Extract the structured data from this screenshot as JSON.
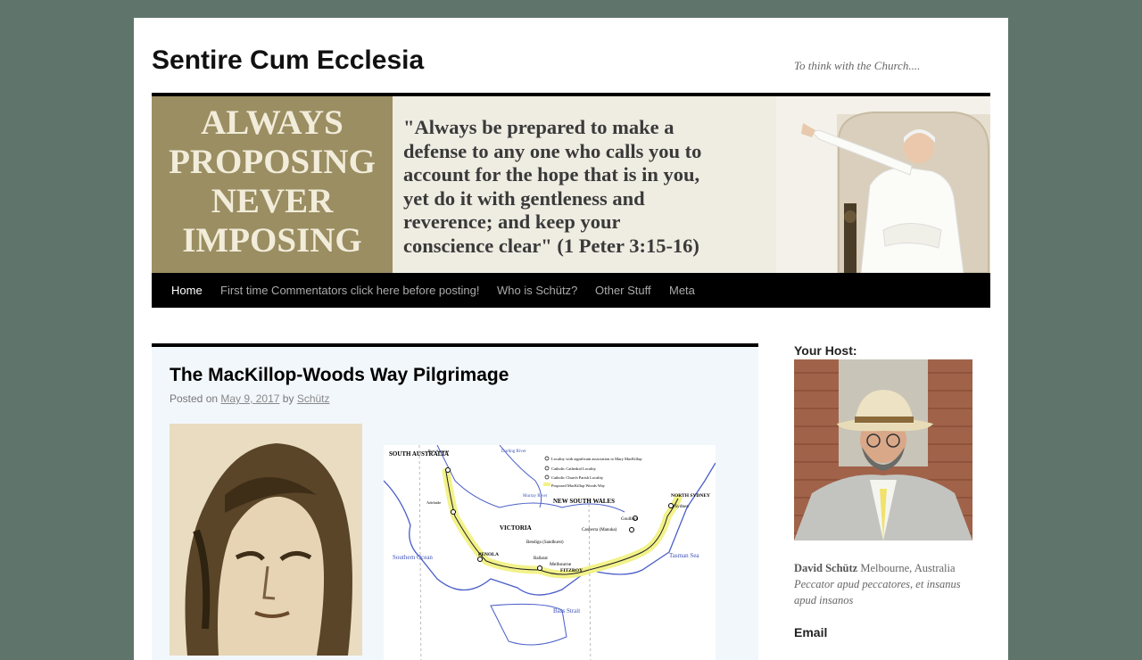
{
  "site": {
    "title": "Sentire Cum Ecclesia",
    "tagline": "To think with the Church...."
  },
  "banner": {
    "left_lines": [
      "ALWAYS",
      "PROPOSING",
      "NEVER",
      "IMPOSING"
    ],
    "quote_lines": [
      "\"Always be prepared to make a",
      "defense to any one who calls you to",
      "account for the hope that is in you,",
      "yet do it with gentleness and",
      "reverence; and keep your",
      "conscience clear\" (1 Peter 3:15-16)"
    ]
  },
  "nav": {
    "items": [
      {
        "label": "Home",
        "active": true
      },
      {
        "label": "First time Commentators click here before posting!"
      },
      {
        "label": "Who is Schütz?"
      },
      {
        "label": "Other Stuff"
      },
      {
        "label": "Meta"
      }
    ]
  },
  "post": {
    "title": "The MacKillop-Woods Way Pilgrimage",
    "meta_prefix": "Posted on",
    "date": "May 9, 2017",
    "meta_by": "by",
    "author": "Schütz"
  },
  "map": {
    "labels": {
      "sa": "SOUTH AUSTRALIA",
      "nsw": "NEW SOUTH WALES",
      "vic": "VICTORIA",
      "southern_ocean": "Southern Ocean",
      "tasman": "Tasman Sea",
      "bass": "Bass Strait",
      "north_sydney": "NORTH SYDNEY",
      "sydney": "Sydney",
      "penola": "PENOLA",
      "fitzroy": "FITZROY",
      "melbourne": "Melbourne",
      "darling": "Darling River",
      "murray": "Murray River",
      "canberra": "Canberra (Manuka)",
      "goulburn": "Goulburn",
      "bendigo": "Bendigo (Sandhurst)",
      "ballarat": "Ballarat",
      "port_augusta": "Port Augusta",
      "adelaide": "Adelaide",
      "legend_1": "Locality with significant association to Mary MacKillop",
      "legend_2": "Catholic Cathedral Locality",
      "legend_3": "Catholic Church Parish Locality",
      "legend_4": "Proposed MacKillop Woods Way"
    }
  },
  "sidebar": {
    "host_heading": "Your Host:",
    "host_name": "David Schütz",
    "host_location": "Melbourne, Australia",
    "host_motto": "Peccator apud peccatores, et insanus apud insanos",
    "email_heading": "Email"
  },
  "colors": {
    "background": "#5f756c",
    "banner_left": "#9a8e62",
    "nav_bg": "#000000",
    "post_bg": "#f2f7fc",
    "map_route": "#f2f28a"
  }
}
